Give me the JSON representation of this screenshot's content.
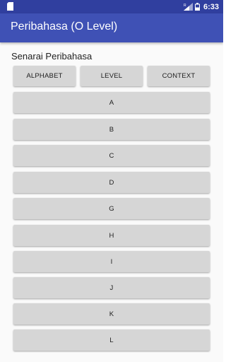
{
  "status_bar": {
    "time": "6:33",
    "icons": [
      "sd-card-icon",
      "signal-icon",
      "battery-icon"
    ]
  },
  "app_bar": {
    "title": "Peribahasa (O Level)"
  },
  "content": {
    "section_label": "Senarai Peribahasa",
    "sort_buttons": [
      {
        "label": "ALPHABET"
      },
      {
        "label": "LEVEL"
      },
      {
        "label": "CONTEXT"
      }
    ],
    "letters": [
      {
        "label": "A"
      },
      {
        "label": "B"
      },
      {
        "label": "C"
      },
      {
        "label": "D"
      },
      {
        "label": "G"
      },
      {
        "label": "H"
      },
      {
        "label": "I"
      },
      {
        "label": "J"
      },
      {
        "label": "K"
      },
      {
        "label": "L"
      }
    ]
  },
  "colors": {
    "status_bar": "#303f9f",
    "app_bar": "#3f51b5",
    "button": "#d6d6d6",
    "background": "#fafafa"
  }
}
